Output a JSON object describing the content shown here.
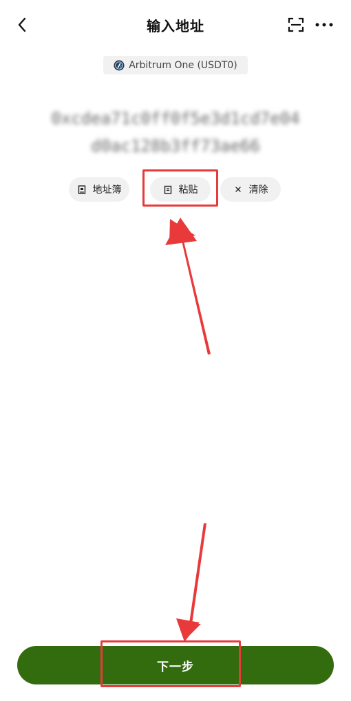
{
  "header": {
    "title": "输入地址",
    "back_icon": "chevron-left-icon",
    "scan_icon": "scan-icon",
    "more_icon": "more-dots-icon"
  },
  "network": {
    "label": "Arbitrum One (USDT0)",
    "icon": "arbitrum-logo-icon"
  },
  "address": {
    "line1": "0xcdea71c0ff0f5e3d1cd7e04",
    "line2": "d0ac128b3ff73ae66"
  },
  "actions": {
    "address_book_label": "地址簿",
    "paste_label": "粘贴",
    "clear_label": "清除"
  },
  "next_button": {
    "label": "下一步"
  },
  "colors": {
    "primary": "#336b0f",
    "chip_bg": "#f1f1f1",
    "annotation": "#e83a3a"
  }
}
